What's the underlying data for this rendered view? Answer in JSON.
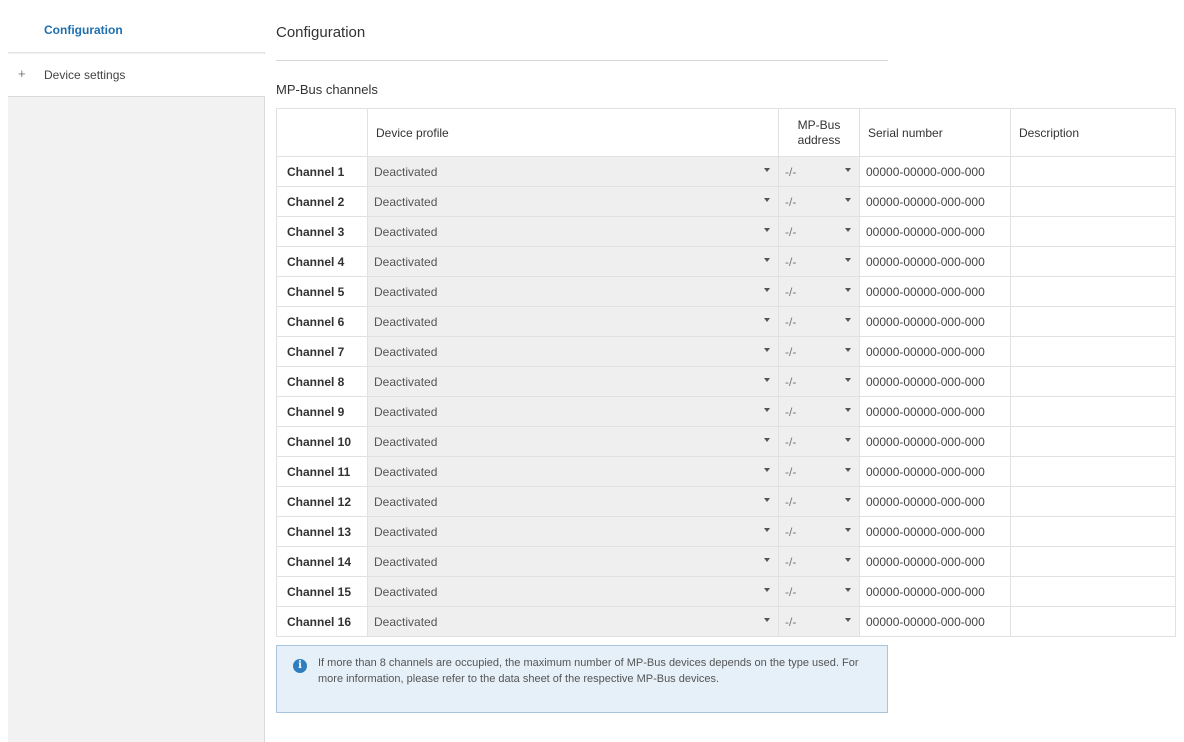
{
  "sidebar": {
    "items": [
      {
        "label": "Configuration",
        "active": true
      },
      {
        "label": "Device settings",
        "expand_icon": "plus-icon",
        "active": false
      }
    ]
  },
  "main": {
    "title": "Configuration",
    "section_title": "MP-Bus channels",
    "table": {
      "headers": {
        "channel": "",
        "device_profile": "Device profile",
        "mp_bus_address_line1": "MP-Bus",
        "mp_bus_address_line2": "address",
        "serial_number": "Serial number",
        "description": "Description"
      },
      "rows": [
        {
          "channel": "Channel 1",
          "device_profile": "Deactivated",
          "address": "-/-",
          "serial": "00000-00000-000-000",
          "description": ""
        },
        {
          "channel": "Channel 2",
          "device_profile": "Deactivated",
          "address": "-/-",
          "serial": "00000-00000-000-000",
          "description": ""
        },
        {
          "channel": "Channel 3",
          "device_profile": "Deactivated",
          "address": "-/-",
          "serial": "00000-00000-000-000",
          "description": ""
        },
        {
          "channel": "Channel 4",
          "device_profile": "Deactivated",
          "address": "-/-",
          "serial": "00000-00000-000-000",
          "description": ""
        },
        {
          "channel": "Channel 5",
          "device_profile": "Deactivated",
          "address": "-/-",
          "serial": "00000-00000-000-000",
          "description": ""
        },
        {
          "channel": "Channel 6",
          "device_profile": "Deactivated",
          "address": "-/-",
          "serial": "00000-00000-000-000",
          "description": ""
        },
        {
          "channel": "Channel 7",
          "device_profile": "Deactivated",
          "address": "-/-",
          "serial": "00000-00000-000-000",
          "description": ""
        },
        {
          "channel": "Channel 8",
          "device_profile": "Deactivated",
          "address": "-/-",
          "serial": "00000-00000-000-000",
          "description": ""
        },
        {
          "channel": "Channel 9",
          "device_profile": "Deactivated",
          "address": "-/-",
          "serial": "00000-00000-000-000",
          "description": ""
        },
        {
          "channel": "Channel 10",
          "device_profile": "Deactivated",
          "address": "-/-",
          "serial": "00000-00000-000-000",
          "description": ""
        },
        {
          "channel": "Channel 11",
          "device_profile": "Deactivated",
          "address": "-/-",
          "serial": "00000-00000-000-000",
          "description": ""
        },
        {
          "channel": "Channel 12",
          "device_profile": "Deactivated",
          "address": "-/-",
          "serial": "00000-00000-000-000",
          "description": ""
        },
        {
          "channel": "Channel 13",
          "device_profile": "Deactivated",
          "address": "-/-",
          "serial": "00000-00000-000-000",
          "description": ""
        },
        {
          "channel": "Channel 14",
          "device_profile": "Deactivated",
          "address": "-/-",
          "serial": "00000-00000-000-000",
          "description": ""
        },
        {
          "channel": "Channel 15",
          "device_profile": "Deactivated",
          "address": "-/-",
          "serial": "00000-00000-000-000",
          "description": ""
        },
        {
          "channel": "Channel 16",
          "device_profile": "Deactivated",
          "address": "-/-",
          "serial": "00000-00000-000-000",
          "description": ""
        }
      ]
    },
    "info": {
      "icon": "info-icon",
      "glyph": "i",
      "text": "If more than 8 channels are occupied, the maximum number of MP-Bus devices depends on the type used. For more information, please refer to the data sheet of the respective MP-Bus devices."
    }
  },
  "colors": {
    "accent": "#1e6fb0",
    "sidebar_bg": "#f2f2f2",
    "select_bg": "#efefef",
    "info_bg": "#e6f0f8",
    "info_border": "#a9c4dc",
    "info_icon": "#2f7fc0"
  }
}
